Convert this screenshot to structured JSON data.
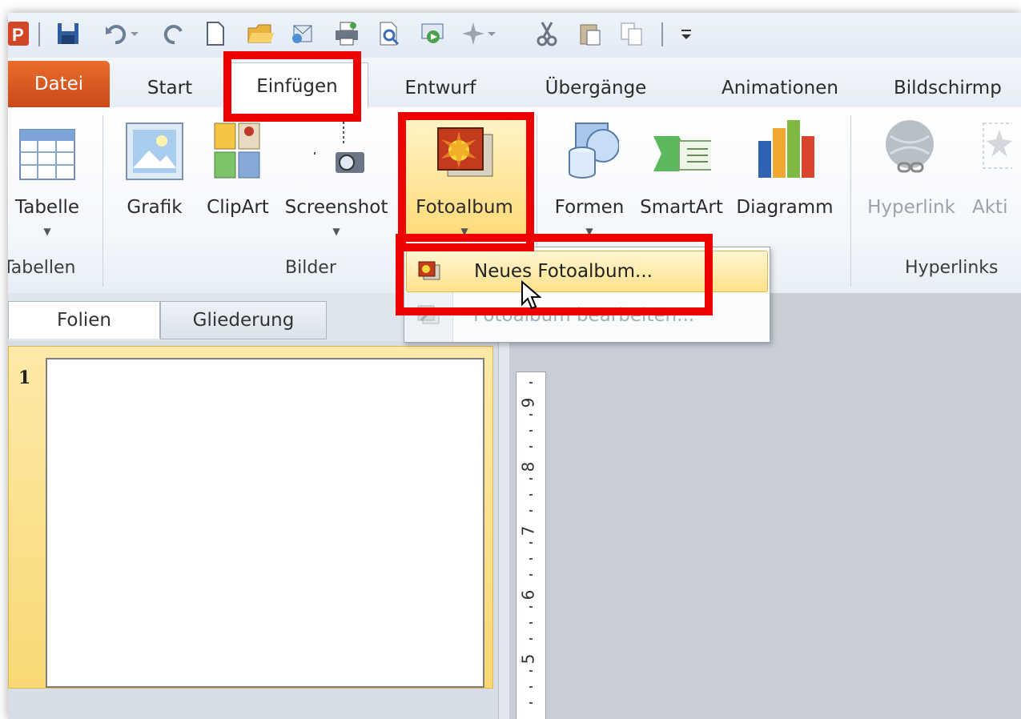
{
  "quick_access": {
    "items": [
      "powerpoint-logo-icon",
      "save-icon",
      "undo-icon",
      "undo-dropdown-icon",
      "redo-icon",
      "new-icon",
      "open-icon",
      "email-icon",
      "print-icon",
      "print-preview-icon",
      "slideshow-icon",
      "sparkle-icon",
      "sparkle-dropdown-icon",
      "cut-icon",
      "paste-icon",
      "copy-icon",
      "customize-icon"
    ]
  },
  "tabs": {
    "datei": "Datei",
    "start": "Start",
    "einfuegen": "Einfügen",
    "entwurf": "Entwurf",
    "uebergaenge": "Übergänge",
    "animationen": "Animationen",
    "bildschirm": "Bildschirmp"
  },
  "ribbon": {
    "tabelle": "Tabelle",
    "grafik": "Grafik",
    "clipart": "ClipArt",
    "screenshot": "Screenshot",
    "fotoalbum": "Fotoalbum",
    "formen": "Formen",
    "smartart": "SmartArt",
    "diagramm": "Diagramm",
    "hyperlink": "Hyperlink",
    "aktion": "Akti",
    "groups": {
      "tabellen": "Tabellen",
      "bilder": "Bilder",
      "hyperlinks": "Hyperlinks"
    }
  },
  "dropdown": {
    "neues_fotoalbum": "Neues Fotoalbum...",
    "fotoalbum_bearbeiten": "Fotoalbum bearbeiten..."
  },
  "panel": {
    "folien": "Folien",
    "gliederung": "Gliederung",
    "slide_number": "1"
  },
  "ruler": {
    "labels": [
      "9",
      "8",
      "7",
      "6",
      "5"
    ]
  },
  "colors": {
    "datei_tab": "#d65a22",
    "annotation_red": "#ee0000",
    "highlight": "#ffd974"
  }
}
